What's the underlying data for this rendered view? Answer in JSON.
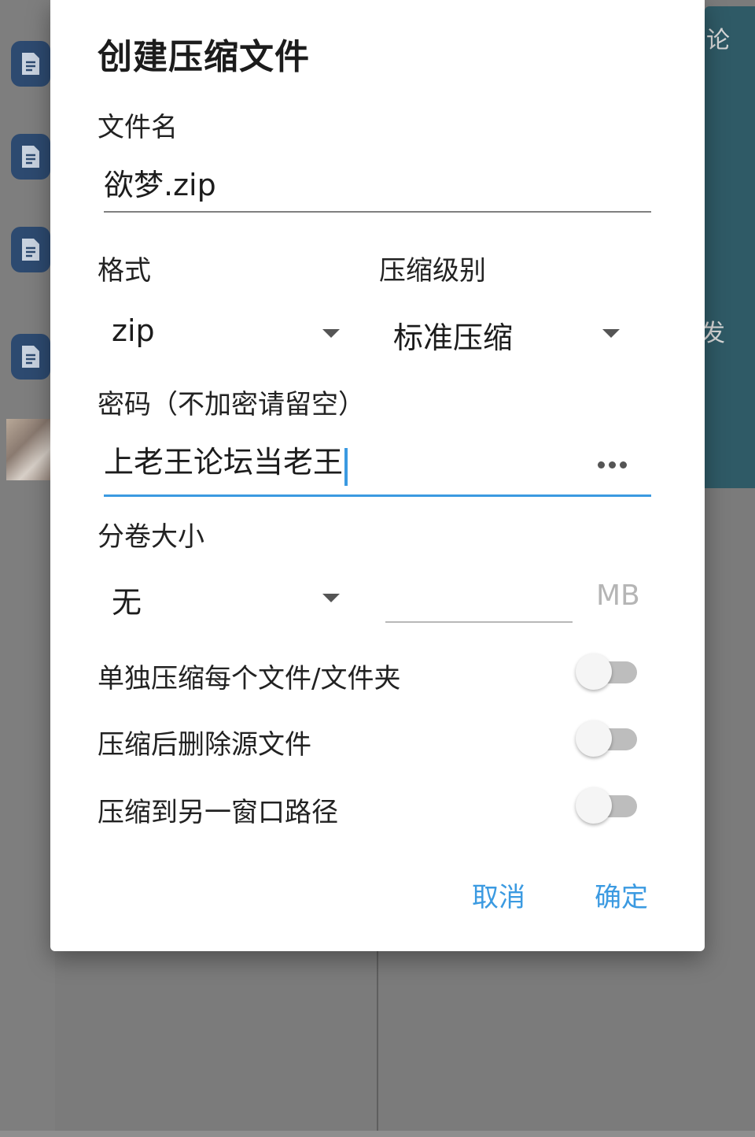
{
  "background": {
    "right_panel_texts": [
      "论",
      "发"
    ]
  },
  "dialog": {
    "title": "创建压缩文件",
    "filename": {
      "label": "文件名",
      "value": "欲梦.zip"
    },
    "format": {
      "label": "格式",
      "value": "zip"
    },
    "compression_level": {
      "label": "压缩级别",
      "value": "标准压缩"
    },
    "password": {
      "label": "密码（不加密请留空）",
      "value": "上老王论坛当老王"
    },
    "split_size": {
      "label": "分卷大小",
      "value": "无",
      "size_value": "",
      "unit": "MB"
    },
    "options": [
      {
        "label": "单独压缩每个文件/文件夹",
        "enabled": false
      },
      {
        "label": "压缩后删除源文件",
        "enabled": false
      },
      {
        "label": "压缩到另一窗口路径",
        "enabled": false
      }
    ],
    "buttons": {
      "cancel": "取消",
      "confirm": "确定"
    }
  },
  "colors": {
    "accent": "#3b9ae1",
    "dialog_bg": "#ffffff",
    "scrim": "#7b7b7b",
    "file_icon": "#2d4a70",
    "side_panel": "#2f5a66"
  }
}
